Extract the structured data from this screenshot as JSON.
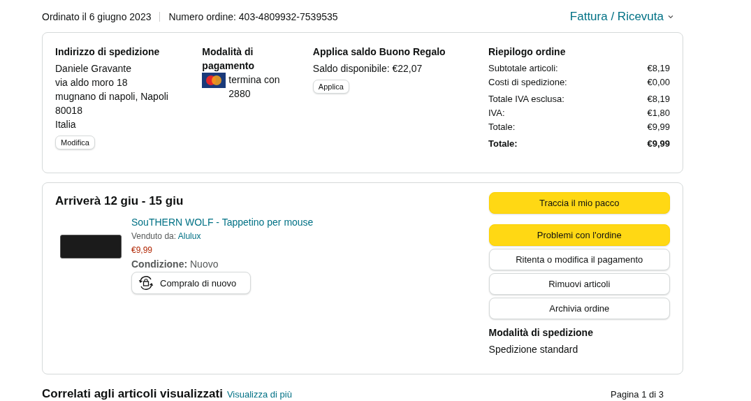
{
  "order_meta": {
    "ordered": "Ordinato il 6 giugno 2023",
    "number": "Numero ordine: 403-4809932-7539535",
    "invoice_link": "Fattura / Ricevuta"
  },
  "shipping_address": {
    "title": "Indirizzo di spedizione",
    "lines": [
      "Daniele Gravante",
      "via aldo moro 18",
      "mugnano di napoli, Napoli",
      "80018",
      "Italia"
    ],
    "button": "Modifica"
  },
  "payment": {
    "title": "Modalità di pagamento",
    "card_text": "termina con 2880"
  },
  "gift_card": {
    "title": "Applica saldo Buono Regalo",
    "balance": "Saldo disponibile: €22,07",
    "button": "Applica"
  },
  "summary": {
    "title": "Riepilogo ordine",
    "rows": [
      {
        "label": "Subtotale articoli:",
        "value": "€8,19",
        "kind": "line"
      },
      {
        "label": "Costi di spedizione:",
        "value": "€0,00",
        "kind": "line"
      },
      {
        "label": "Totale IVA esclusa:",
        "value": "€8,19",
        "kind": "line"
      },
      {
        "label": "IVA:",
        "value": "€1,80",
        "kind": "line"
      },
      {
        "label": "Totale:",
        "value": "€9,99",
        "kind": "line"
      },
      {
        "label": "Totale:",
        "value": "€9,99",
        "kind": "total"
      }
    ]
  },
  "shipment": {
    "arrival": "Arriverà 12 giu - 15 giu",
    "item": {
      "title": "SouTHERN WOLF - Tappetino per mouse",
      "sold_by_label": "Venduto da:",
      "seller": "Alulux",
      "price": "€9,99",
      "condition_label": "Condizione:",
      "condition": "Nuovo",
      "buy_again": "Compralo di nuovo"
    },
    "actions": [
      {
        "label": "Traccia il mio pacco",
        "kind": "primary"
      },
      {
        "label": "Problemi con l'ordine",
        "kind": "primary"
      },
      {
        "label": "Ritenta o modifica il pagamento",
        "kind": "secondary"
      },
      {
        "label": "Rimuovi articoli",
        "kind": "secondary"
      },
      {
        "label": "Archivia ordine",
        "kind": "secondary"
      }
    ],
    "shipping_method_title": "Modalità di spedizione",
    "shipping_method": "Spedizione standard"
  },
  "related": {
    "title": "Correlati agli articoli visualizzati",
    "link": "Visualizza di più",
    "page": "Pagina 1 di 3"
  }
}
